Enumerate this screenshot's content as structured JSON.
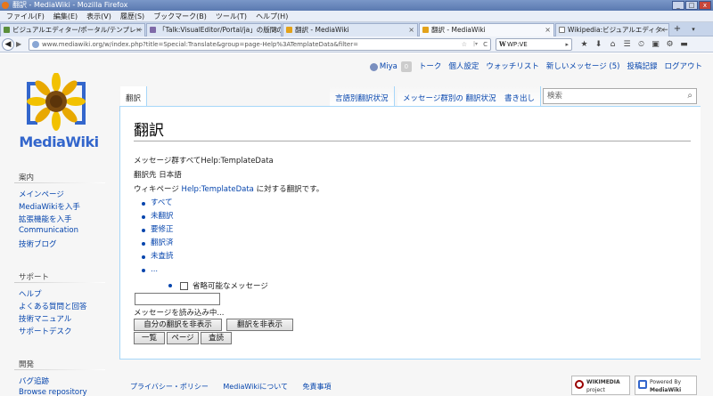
{
  "window": {
    "title": "翻訳 - MediaWiki - Mozilla Firefox",
    "buttons": [
      "_",
      "□",
      "x"
    ]
  },
  "menu": [
    "ファイル(F)",
    "編集(E)",
    "表示(V)",
    "履歴(S)",
    "ブックマーク(B)",
    "ツール(T)",
    "ヘルプ(H)"
  ],
  "tabs": [
    {
      "label": "ビジュアルエディター/ポータル/テンプレート...",
      "active": false
    },
    {
      "label": "「Talk:VisualEditor/Portal/ja」の版間の...",
      "active": false
    },
    {
      "label": "翻訳 - MediaWiki",
      "active": false
    },
    {
      "label": "翻訳 - MediaWiki",
      "active": true
    },
    {
      "label": "Wikipedia:ビジュアルエディター/フィードバッ...",
      "active": false
    }
  ],
  "tabstrip": {
    "new_tab": "+",
    "list": "▾"
  },
  "nav": {
    "back": "◀",
    "forward": "▶",
    "url": "www.mediawiki.org/w/index.php?title=Special:Translate&group=page-Help%3ATemplateData&filter=",
    "star": "☆",
    "bmk": "|▾",
    "reload": "C",
    "search_engine": "W",
    "search_value": "WP:VE",
    "search_go": "▸",
    "icons": [
      "★",
      "⬇",
      "⌂",
      "☰",
      "⏲",
      "▣",
      "⚙",
      "▬"
    ]
  },
  "wiki": {
    "logo_text": "MediaWiki",
    "personal": {
      "username": "Miya",
      "notifications": "0",
      "links": [
        "トーク",
        "個人設定",
        "ウォッチリスト",
        "新しいメッセージ (5)",
        "投稿記録",
        "ログアウト"
      ]
    },
    "page_tab": "翻訳",
    "action_tabs": [
      "言語別翻訳状況",
      "メッセージ群別の 翻訳状況",
      "書き出し"
    ],
    "search_placeholder": "検索",
    "search_icon": "⌕",
    "heading": "翻訳",
    "group_prefix": "メッセージ群",
    "group_value": "すべてHelp:TemplateData",
    "target_prefix": "翻訳先",
    "target_value": "日本語",
    "wikipage_prefix": "ウィキページ",
    "wikipage_link": "Help:TemplateData",
    "wikipage_suffix": "に対する翻訳です。",
    "filters": [
      "すべて",
      "未翻訳",
      "要修正",
      "翻訳済",
      "未査読",
      "..."
    ],
    "optional_label": "省略可能なメッセージ",
    "loading": "メッセージを読み込み中...",
    "buttons": {
      "hide_own": "自分の翻訳を非表示",
      "hide_translations": "翻訳を非表示",
      "list": "一覧",
      "page": "ページ",
      "review": "査読"
    },
    "footer": [
      "プライバシー・ポリシー",
      "MediaWikiについて",
      "免責事項"
    ],
    "footer_logos": {
      "wikimedia": [
        "WIKIMEDIA",
        "project"
      ],
      "poweredby": [
        "Powered By",
        "MediaWiki"
      ]
    }
  },
  "sidebar": {
    "sections": [
      {
        "heading": "案内",
        "items": [
          "メインページ",
          "MediaWikiを入手",
          "拡張機能を入手",
          "Communication",
          "技術ブログ"
        ]
      },
      {
        "heading": "サポート",
        "items": [
          "ヘルプ",
          "よくある質問と回答",
          "技術マニュアル",
          "サポートデスク"
        ]
      },
      {
        "heading": "開発",
        "items": [
          "バグ追跡",
          "Browse repository"
        ]
      }
    ]
  },
  "colors": {
    "link": "#0645ad",
    "logo_blue": "#3366cc",
    "titlebar": "#5a79b0",
    "tab_border": "#a7d7f9"
  }
}
